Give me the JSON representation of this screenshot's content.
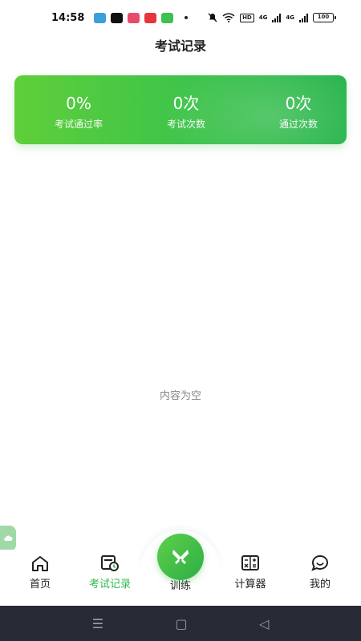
{
  "status_bar": {
    "time": "14:58",
    "signal1": "4G",
    "signal2": "4G",
    "hd": "HD",
    "battery": "100",
    "icons": [
      "app-notification-icon",
      "tiktok-icon",
      "app-icon-3",
      "app-icon-4",
      "message-icon"
    ],
    "icon_colors": [
      "#3aa0d8",
      "#111111",
      "#e84a6b",
      "#e8343f",
      "#3cc24f"
    ]
  },
  "header": {
    "title": "考试记录"
  },
  "stats": [
    {
      "value": "0%",
      "label": "考试通过率"
    },
    {
      "value": "0次",
      "label": "考试次数"
    },
    {
      "value": "0次",
      "label": "通过次数"
    }
  ],
  "empty_state": {
    "text": "内容为空"
  },
  "bottom_nav": {
    "items": [
      {
        "label": "首页",
        "icon": "home-icon"
      },
      {
        "label": "考试记录",
        "icon": "exam-record-icon",
        "active": true
      },
      {
        "label": "训练",
        "icon": "train-icon"
      },
      {
        "label": "计算器",
        "icon": "calculator-icon"
      },
      {
        "label": "我的",
        "icon": "profile-icon"
      }
    ],
    "active_color": "#2fb84a"
  },
  "system_nav": {
    "menu": "☰",
    "home": "▢",
    "back": "◁"
  },
  "colors": {
    "accent": "#2fb84a",
    "card_start": "#5fcf3a",
    "card_end": "#27b44c"
  }
}
